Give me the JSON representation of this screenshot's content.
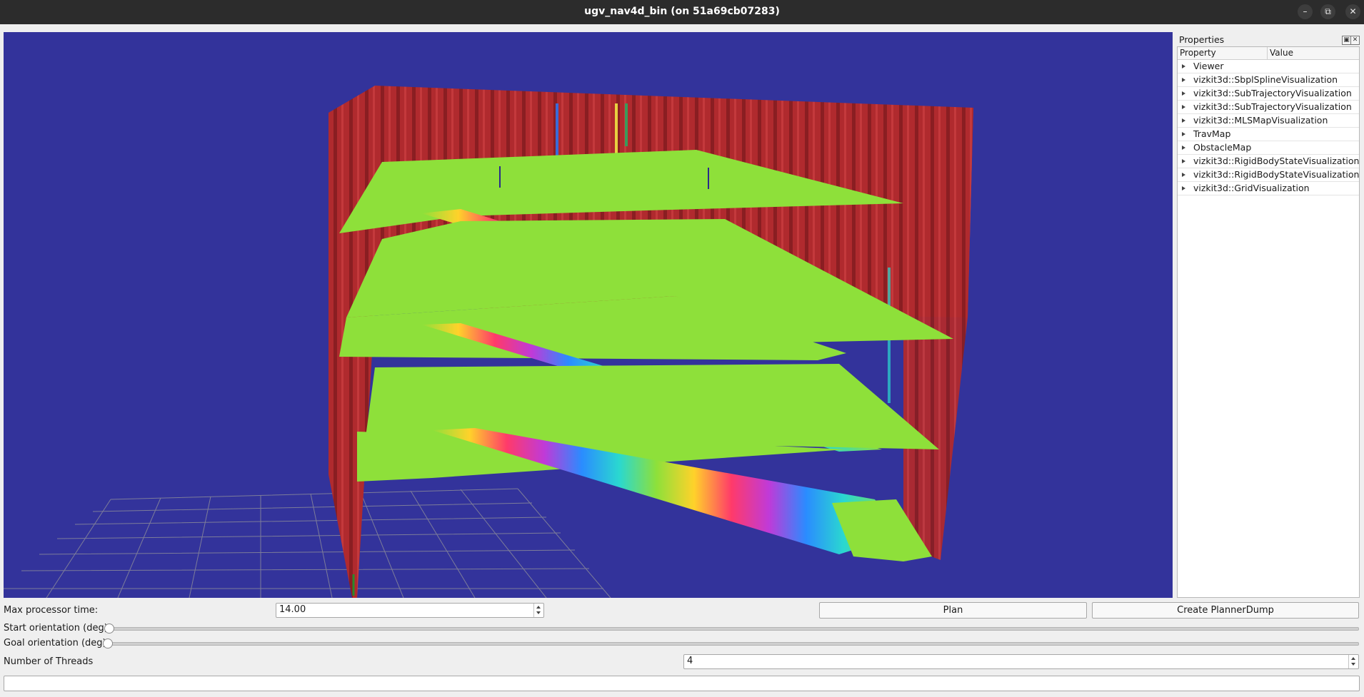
{
  "window": {
    "title": "ugv_nav4d_bin (on 51a69cb07283)",
    "controls": [
      "minimize-icon",
      "maximize-icon",
      "close-icon"
    ]
  },
  "viewport": {
    "background": "#33339b",
    "colors": {
      "wall": "#b02a2e",
      "floor": "#8ee03a",
      "grid": "#8f8f99"
    }
  },
  "properties": {
    "title": "Properties",
    "columns": {
      "property": "Property",
      "value": "Value"
    },
    "items": [
      {
        "label": "Viewer"
      },
      {
        "label": "vizkit3d::SbplSplineVisualization"
      },
      {
        "label": "vizkit3d::SubTrajectoryVisualization"
      },
      {
        "label": "vizkit3d::SubTrajectoryVisualization"
      },
      {
        "label": "vizkit3d::MLSMapVisualization"
      },
      {
        "label": "TravMap"
      },
      {
        "label": "ObstacleMap"
      },
      {
        "label": "vizkit3d::RigidBodyStateVisualization"
      },
      {
        "label": "vizkit3d::RigidBodyStateVisualization"
      },
      {
        "label": "vizkit3d::GridVisualization"
      }
    ]
  },
  "controls": {
    "max_processor_time": {
      "label": "Max processor time:",
      "value": "14.00"
    },
    "plan_button": "Plan",
    "create_dump_button": "Create PlannerDump",
    "start_orientation": {
      "label": "Start orientation (deg)"
    },
    "goal_orientation": {
      "label": "Goal orientation (deg)"
    },
    "threads": {
      "label": "Number of Threads",
      "value": "4"
    },
    "status_text": ""
  }
}
